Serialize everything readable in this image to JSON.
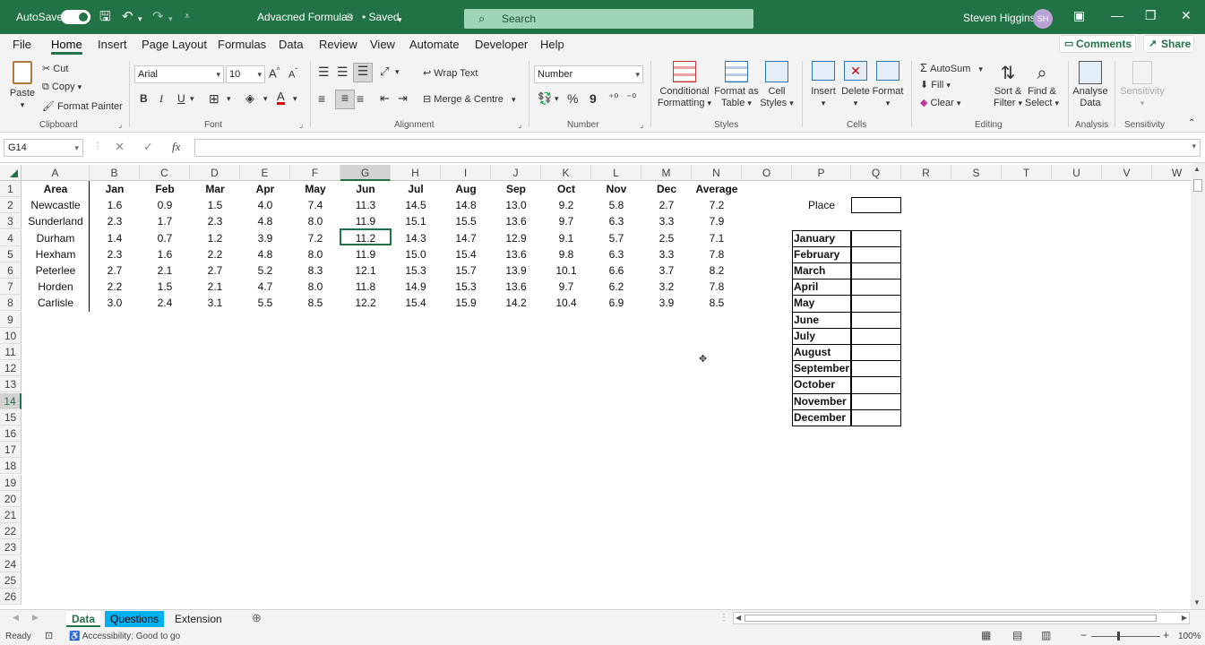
{
  "titlebar": {
    "autosave_label": "AutoSave",
    "file_name": "Advacned Formulas",
    "saved_status": "• Saved",
    "search_placeholder": "Search",
    "user_name": "Steven Higgins",
    "user_initials": "SH"
  },
  "menu": {
    "tabs": [
      "File",
      "Home",
      "Insert",
      "Page Layout",
      "Formulas",
      "Data",
      "Review",
      "View",
      "Automate",
      "Developer",
      "Help"
    ],
    "active": "Home",
    "comments_label": "Comments",
    "share_label": "Share"
  },
  "ribbon": {
    "clipboard": {
      "paste": "Paste",
      "cut": "Cut",
      "copy": "Copy",
      "format_painter": "Format Painter",
      "label": "Clipboard"
    },
    "font": {
      "name": "Arial",
      "size": "10",
      "bold": "B",
      "italic": "I",
      "underline": "U",
      "label": "Font"
    },
    "alignment": {
      "wrap_text": "Wrap Text",
      "merge_centre": "Merge & Centre",
      "label": "Alignment"
    },
    "number": {
      "format": "Number",
      "percent": "%",
      "comma": "9",
      "label": "Number"
    },
    "styles": {
      "conditional_line1": "Conditional",
      "conditional_line2": "Formatting",
      "format_table_line1": "Format as",
      "format_table_line2": "Table",
      "cell_styles_line1": "Cell",
      "cell_styles_line2": "Styles",
      "label": "Styles"
    },
    "cells": {
      "insert": "Insert",
      "delete": "Delete",
      "format": "Format",
      "label": "Cells"
    },
    "editing": {
      "autosum": "AutoSum",
      "fill": "Fill",
      "clear": "Clear",
      "sort_line1": "Sort &",
      "sort_line2": "Filter",
      "find_line1": "Find &",
      "find_line2": "Select",
      "label": "Editing"
    },
    "analysis": {
      "analyse_line1": "Analyse",
      "analyse_line2": "Data",
      "label": "Analysis"
    },
    "sensitivity": {
      "button": "Sensitivity",
      "label": "Sensitivity"
    }
  },
  "formula_bar": {
    "name_box": "G14",
    "fx": "fx",
    "content": ""
  },
  "columns": [
    "A",
    "B",
    "C",
    "D",
    "E",
    "F",
    "G",
    "H",
    "I",
    "J",
    "K",
    "L",
    "M",
    "N",
    "O",
    "P",
    "Q",
    "R",
    "S",
    "T",
    "U",
    "V",
    "W"
  ],
  "rows": [
    "1",
    "2",
    "3",
    "4",
    "5",
    "6",
    "7",
    "8",
    "9",
    "10",
    "11",
    "12",
    "13",
    "14",
    "15",
    "16",
    "17",
    "18",
    "19",
    "20",
    "21",
    "22",
    "23",
    "24",
    "25",
    "26"
  ],
  "table": {
    "headers": [
      "Area",
      "Jan",
      "Feb",
      "Mar",
      "Apr",
      "May",
      "Jun",
      "Jul",
      "Aug",
      "Sep",
      "Oct",
      "Nov",
      "Dec",
      "Average"
    ],
    "rows": [
      [
        "Newcastle",
        "1.6",
        "0.9",
        "1.5",
        "4.0",
        "7.4",
        "11.3",
        "14.5",
        "14.8",
        "13.0",
        "9.2",
        "5.8",
        "2.7",
        "7.2"
      ],
      [
        "Sunderland",
        "2.3",
        "1.7",
        "2.3",
        "4.8",
        "8.0",
        "11.9",
        "15.1",
        "15.5",
        "13.6",
        "9.7",
        "6.3",
        "3.3",
        "7.9"
      ],
      [
        "Durham",
        "1.4",
        "0.7",
        "1.2",
        "3.9",
        "7.2",
        "11.2",
        "14.3",
        "14.7",
        "12.9",
        "9.1",
        "5.7",
        "2.5",
        "7.1"
      ],
      [
        "Hexham",
        "2.3",
        "1.6",
        "2.2",
        "4.8",
        "8.0",
        "11.9",
        "15.0",
        "15.4",
        "13.6",
        "9.8",
        "6.3",
        "3.3",
        "7.8"
      ],
      [
        "Peterlee",
        "2.7",
        "2.1",
        "2.7",
        "5.2",
        "8.3",
        "12.1",
        "15.3",
        "15.7",
        "13.9",
        "10.1",
        "6.6",
        "3.7",
        "8.2"
      ],
      [
        "Horden",
        "2.2",
        "1.5",
        "2.1",
        "4.7",
        "8.0",
        "11.8",
        "14.9",
        "15.3",
        "13.6",
        "9.7",
        "6.2",
        "3.2",
        "7.8"
      ],
      [
        "Carlisle",
        "3.0",
        "2.4",
        "3.1",
        "5.5",
        "8.5",
        "12.2",
        "15.4",
        "15.9",
        "14.2",
        "10.4",
        "6.9",
        "3.9",
        "8.5"
      ]
    ]
  },
  "side_panel": {
    "place_label": "Place",
    "months": [
      "January",
      "February",
      "March",
      "April",
      "May",
      "June",
      "July",
      "August",
      "September",
      "October",
      "November",
      "December"
    ]
  },
  "sheets": {
    "tabs": [
      "Data",
      "Questions",
      "Extension"
    ],
    "active": "Data"
  },
  "status": {
    "ready": "Ready",
    "accessibility": "Accessibility: Good to go",
    "zoom": "100%"
  }
}
